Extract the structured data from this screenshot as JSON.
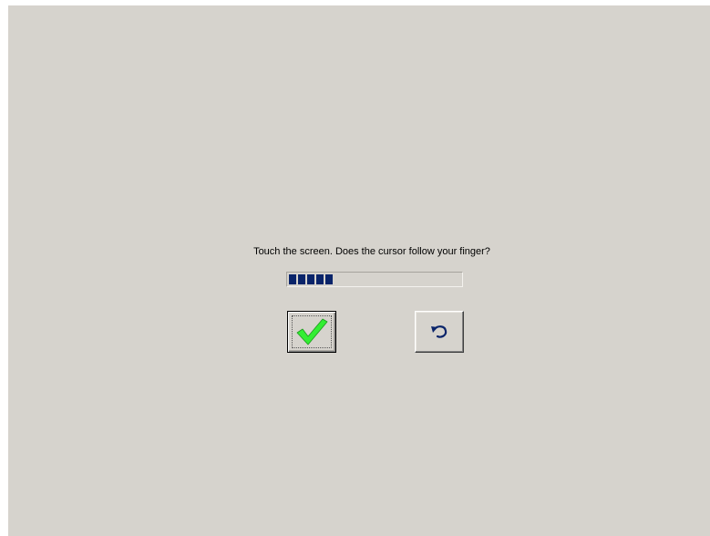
{
  "dialog": {
    "prompt": "Touch the screen. Does the cursor follow your finger?"
  },
  "progress": {
    "segments_filled": 5,
    "color": "#0a246a"
  },
  "buttons": {
    "yes": {
      "icon": "checkmark-icon",
      "color": "#33ee33"
    },
    "back": {
      "icon": "undo-arrow-icon",
      "color": "#0a246a"
    }
  }
}
